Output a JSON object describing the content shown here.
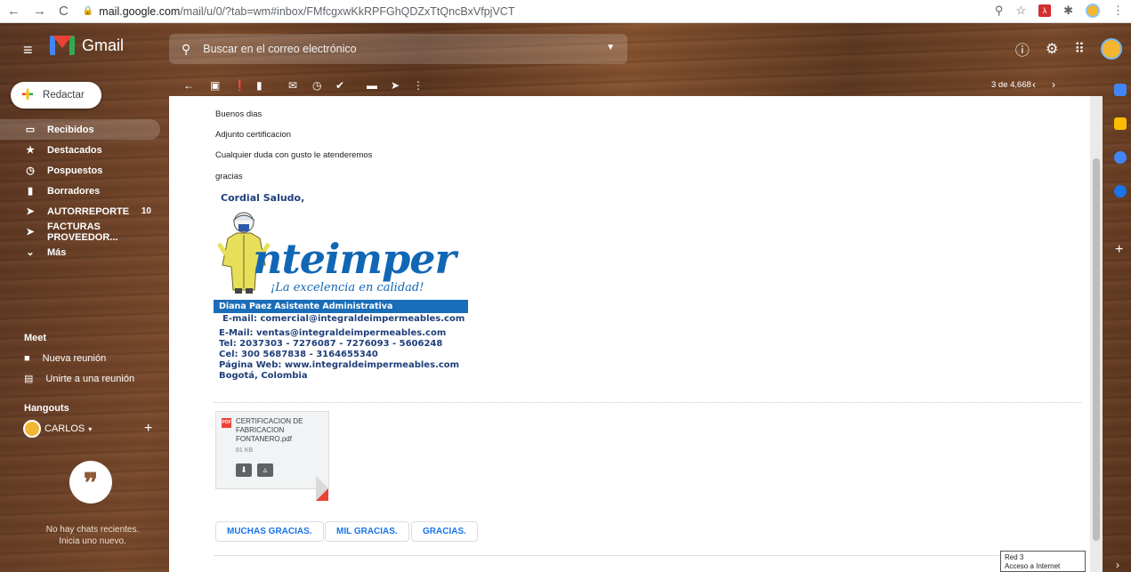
{
  "browser": {
    "url_host": "mail.google.com",
    "url_path": "/mail/u/0/?tab=wm#inbox/FMfcgxwKkRPFGhQDZxTtQncBxVfpjVCT"
  },
  "header": {
    "app_name": "Gmail",
    "search_placeholder": "Buscar en el correo electrónico"
  },
  "compose": {
    "label": "Redactar"
  },
  "sidebar": {
    "items": [
      {
        "label": "Recibidos",
        "icon": "inbox-icon",
        "count": ""
      },
      {
        "label": "Destacados",
        "icon": "star-icon",
        "count": ""
      },
      {
        "label": "Pospuestos",
        "icon": "clock-icon",
        "count": ""
      },
      {
        "label": "Borradores",
        "icon": "draft-icon",
        "count": ""
      },
      {
        "label": "AUTORREPORTE",
        "icon": "label-icon",
        "count": "10"
      },
      {
        "label": "FACTURAS PROVEEDOR...",
        "icon": "label-icon",
        "count": ""
      },
      {
        "label": "Más",
        "icon": "chevron-down-icon",
        "count": ""
      }
    ]
  },
  "meet": {
    "title": "Meet",
    "new_meeting": "Nueva reunión",
    "join_meeting": "Unirte a una reunión"
  },
  "hangouts": {
    "title": "Hangouts",
    "user": "CARLOS",
    "no_chats_line1": "No hay chats recientes.",
    "no_chats_line2": "Inicia uno nuevo."
  },
  "toolbar": {
    "pager": "3 de 4,668"
  },
  "message": {
    "lines": [
      "Buenos dias",
      "Adjunto certificacion",
      "Cualquier duda con gusto le atenderemos",
      "gracias"
    ],
    "signature": {
      "greeting": "Cordial Saludo,",
      "brand": "nteimper",
      "tagline": "¡La excelencia en calidad!",
      "name_bar": "Diana Paez Asistente Administrativa",
      "contact": [
        "E-mail: comercial@integraldeimpermeables.com",
        "E-Mail:  ventas@integraldeimpermeables.com",
        "Tel: 2037303 - 7276087 - 7276093 - 5606248",
        "Cel: 300 5687838 - 3164655340",
        "Página Web: www.integraldeimpermeables.com",
        "Bogotá, Colombia"
      ]
    },
    "attachment": {
      "name": "CERTIFICACION DE FABRICACION FONTANERO.pdf",
      "size": "81 KB",
      "type_badge": "PDF"
    },
    "smart_replies": [
      "MUCHAS GRACIAS.",
      "MIL GRACIAS.",
      "GRACIAS."
    ]
  },
  "tooltip": {
    "line1": "Red 3",
    "line2": "Acceso a Internet"
  },
  "colors": {
    "accent": "#1a73e8",
    "brand_blue": "#1166b6",
    "signature_navy": "#1f3f7a",
    "gmail_red": "#ea4335"
  }
}
